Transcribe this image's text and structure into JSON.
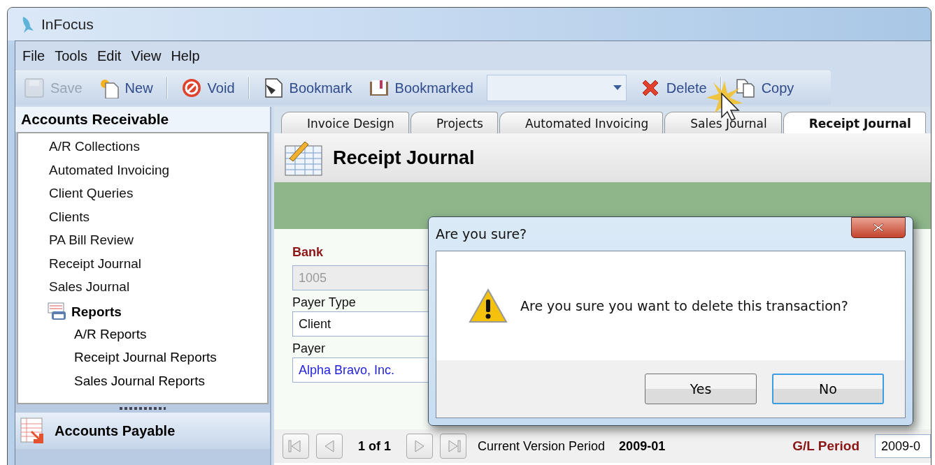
{
  "window": {
    "title": "InFocus"
  },
  "menu": [
    "File",
    "Tools",
    "Edit",
    "View",
    "Help"
  ],
  "toolbar": [
    {
      "kind": "button",
      "label": "Save",
      "disabled": true
    },
    {
      "kind": "button",
      "label": "New",
      "disabled": false
    },
    {
      "kind": "separator"
    },
    {
      "kind": "button",
      "label": "Void",
      "disabled": false
    },
    {
      "kind": "separator"
    },
    {
      "kind": "button",
      "label": "Bookmark",
      "disabled": false
    },
    {
      "kind": "button",
      "label": "Bookmarked",
      "disabled": false
    },
    {
      "kind": "combo"
    },
    {
      "kind": "button",
      "label": "Delete",
      "disabled": false
    },
    {
      "kind": "separator"
    },
    {
      "kind": "button",
      "label": "Copy",
      "disabled": false
    }
  ],
  "sidebar": {
    "title": "Accounts Receivable",
    "items": [
      {
        "kind": "link",
        "label": "A/R Collections"
      },
      {
        "kind": "link",
        "label": "Automated Invoicing"
      },
      {
        "kind": "link",
        "label": "Client Queries"
      },
      {
        "kind": "link",
        "label": "Clients"
      },
      {
        "kind": "link",
        "label": "PA Bill Review"
      },
      {
        "kind": "link",
        "label": "Receipt Journal"
      },
      {
        "kind": "link",
        "label": "Sales Journal"
      },
      {
        "kind": "group",
        "label": "Reports",
        "children": [
          {
            "label": "A/R Reports"
          },
          {
            "label": "Receipt Journal Reports"
          },
          {
            "label": "Sales Journal Reports"
          }
        ]
      }
    ],
    "bottom_section": {
      "label": "Accounts Payable"
    }
  },
  "tabs": [
    {
      "label": "Invoice Design",
      "selected": false
    },
    {
      "label": "Projects",
      "selected": false
    },
    {
      "label": "Automated Invoicing",
      "selected": false
    },
    {
      "label": "Sales Journal",
      "selected": false
    },
    {
      "label": "Receipt Journal",
      "selected": true
    }
  ],
  "page": {
    "title": "Receipt Journal",
    "fields": [
      {
        "label": "Bank",
        "required": true,
        "value": "1005",
        "disabled": true
      },
      {
        "label": "Payer Type",
        "required": false,
        "value": "Client",
        "disabled": false
      },
      {
        "label": "Payer",
        "required": false,
        "value": "Alpha Bravo, Inc.",
        "disabled": false,
        "link": true
      }
    ]
  },
  "footer": {
    "record": "1 of 1",
    "version_label": "Current Version Period",
    "version_value": "2009-01",
    "period_label": "G/L Period",
    "period_value": "2009-0"
  },
  "dialog": {
    "title": "Are you sure?",
    "message": "Are you sure you want to delete this transaction?",
    "buttons": [
      {
        "label": "Yes",
        "default": false
      },
      {
        "label": "No",
        "default": true
      }
    ]
  }
}
